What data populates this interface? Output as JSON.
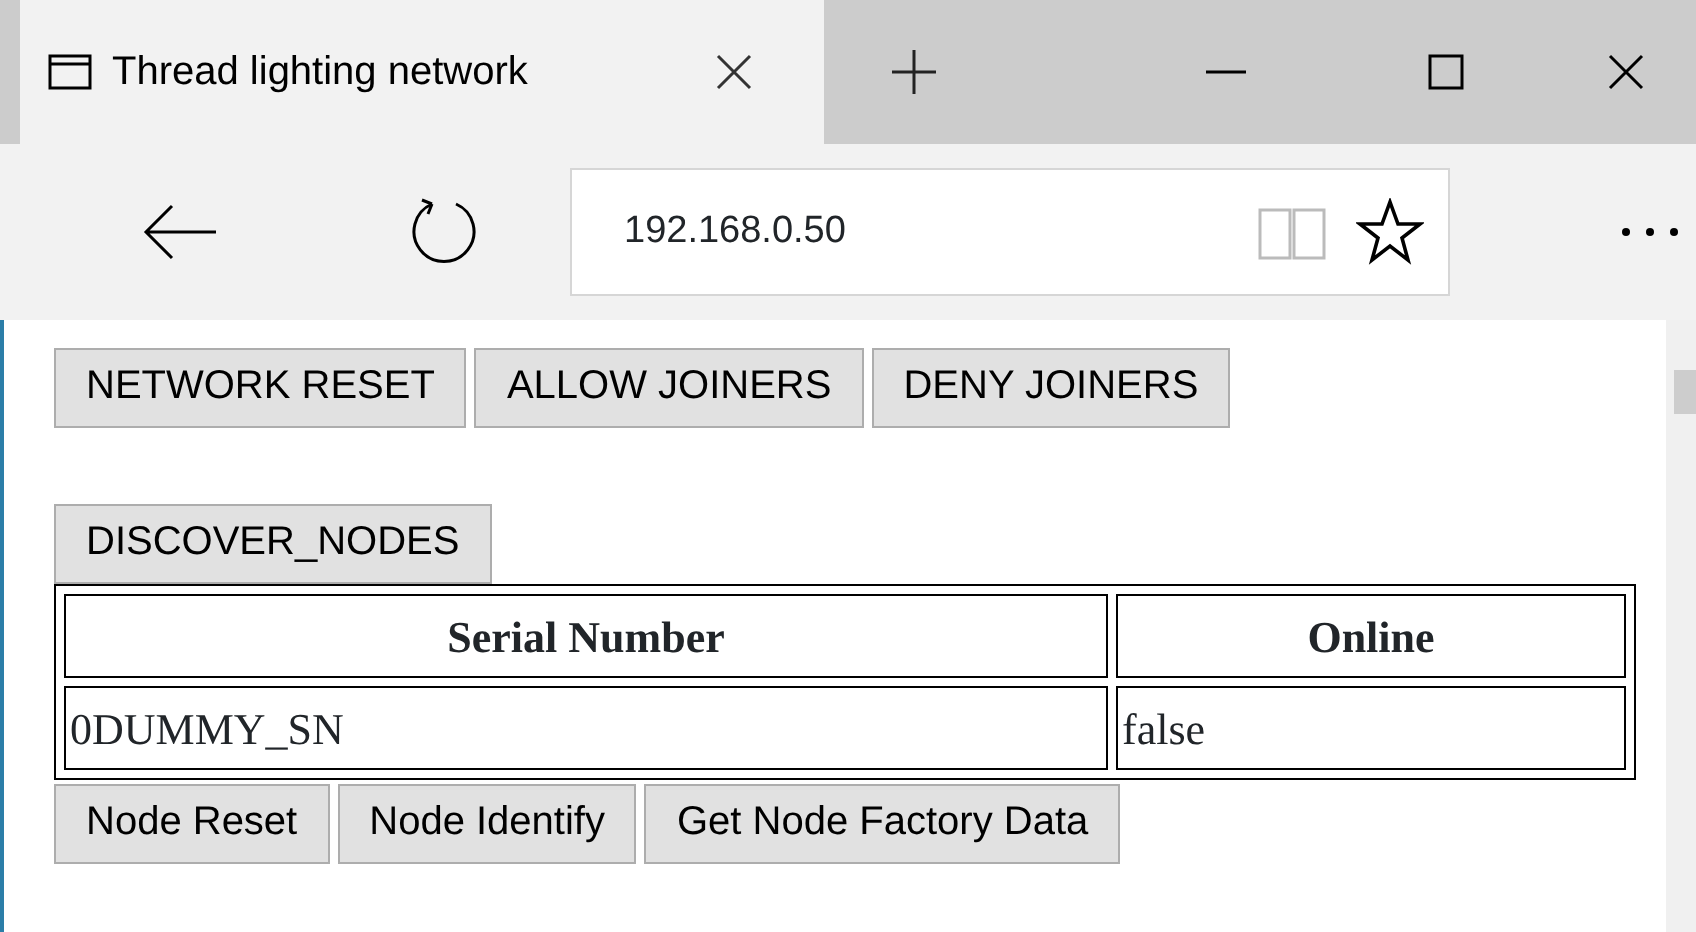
{
  "browser": {
    "tab_title": "Thread lighting network",
    "address": "192.168.0.50"
  },
  "network_buttons": [
    "NETWORK RESET",
    "ALLOW JOINERS",
    "DENY JOINERS"
  ],
  "discover_button": "DISCOVER_NODES",
  "table": {
    "columns": [
      "Serial Number",
      "Online"
    ],
    "rows": [
      [
        "0DUMMY_SN",
        "false"
      ]
    ]
  },
  "node_buttons": [
    "Node Reset",
    "Node Identify",
    "Get Node Factory Data"
  ]
}
